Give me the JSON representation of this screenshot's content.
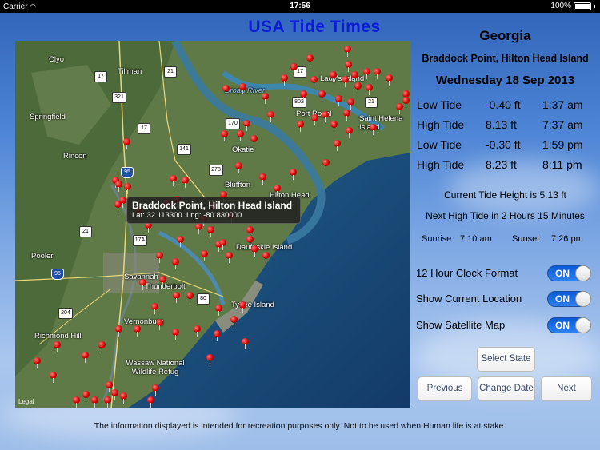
{
  "statusbar": {
    "carrier": "Carrier",
    "time": "17:56",
    "battery": "100%"
  },
  "app_title": "USA Tide Times",
  "state": "Georgia",
  "location": "Braddock Point, Hilton Head Island",
  "date": "Wednesday 18 Sep 2013",
  "tides": [
    {
      "type": "Low Tide",
      "height": "-0.40 ft",
      "time": "1:37 am"
    },
    {
      "type": "High Tide",
      "height": "8.13 ft",
      "time": "7:37 am"
    },
    {
      "type": "Low Tide",
      "height": "-0.30 ft",
      "time": "1:59 pm"
    },
    {
      "type": "High Tide",
      "height": "8.23 ft",
      "time": "8:11 pm"
    }
  ],
  "current_height": "Current Tide Height is 5.13 ft",
  "next_tide": "Next High Tide in 2 Hours 15 Minutes",
  "sunrise": {
    "label": "Sunrise",
    "time": "7:10 am"
  },
  "sunset": {
    "label": "Sunset",
    "time": "7:26 pm"
  },
  "settings": [
    {
      "label": "12 Hour Clock Format",
      "state": "ON"
    },
    {
      "label": "Show Current Location",
      "state": "ON"
    },
    {
      "label": "Show Satellite Map",
      "state": "ON"
    }
  ],
  "buttons": {
    "select_state": "Select State",
    "previous": "Previous",
    "change_date": "Change Date",
    "next": "Next"
  },
  "map": {
    "callout_title": "Braddock Point, Hilton Head Island",
    "callout_coords": "Lat: 32.113300. Lng: -80.830000",
    "legal": "Legal",
    "places": [
      "Clyo",
      "Tillman",
      "Springfield",
      "Rincon",
      "Okatie",
      "Bluffton",
      "Hilton Head",
      "Pooler",
      "Savannah",
      "Thunderbolt",
      "Daufuskie Island",
      "Tybee Island",
      "Vernonburg",
      "Richmond Hill",
      "Lady's Island",
      "Port Royal",
      "Saint Helena Island",
      "Wassaw National Wildlife Refug"
    ],
    "water": [
      "Broad River"
    ],
    "routes": [
      "17",
      "321",
      "17",
      "95",
      "278",
      "21",
      "17A",
      "95",
      "80",
      "204",
      "21",
      "141",
      "170",
      "21",
      "802",
      "17"
    ]
  },
  "footer": "The information displayed is intended for recreation purposes only. Not to be used when Human life is at stake."
}
